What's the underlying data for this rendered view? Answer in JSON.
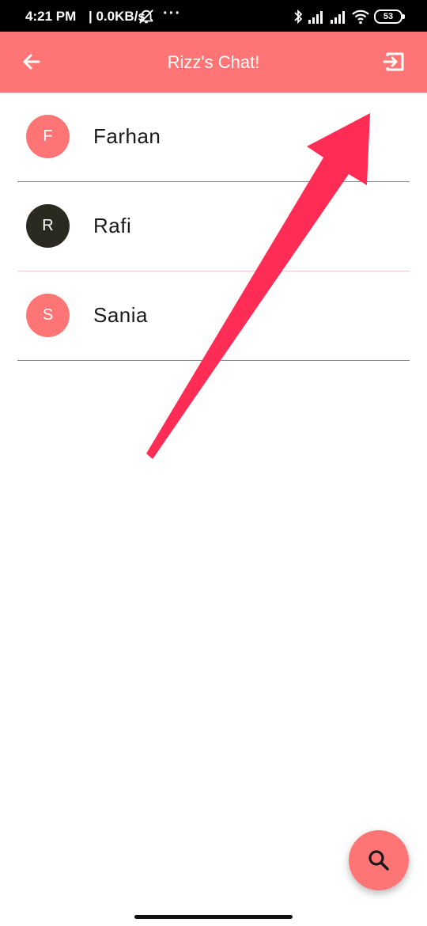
{
  "status_bar": {
    "time": "4:21 PM",
    "net_speed": "| 0.0KB/s",
    "more": "···",
    "battery": "53",
    "icons": [
      "alarm-off-icon",
      "bluetooth-icon",
      "signal-icon",
      "signal-icon",
      "wifi-icon",
      "battery-icon"
    ]
  },
  "app_bar": {
    "title": "Rizz's Chat!",
    "back_icon": "arrow-left-icon",
    "logout_icon": "logout-icon",
    "background": "#ff7575"
  },
  "contacts": [
    {
      "initial": "F",
      "name": "Farhan",
      "avatar_color": "#ff7575"
    },
    {
      "initial": "R",
      "name": "Rafi",
      "avatar_color": "#2b2a20"
    },
    {
      "initial": "S",
      "name": "Sania",
      "avatar_color": "#ff7575"
    }
  ],
  "fab": {
    "icon": "search-icon",
    "background": "#ff7575"
  },
  "annotation": {
    "arrow_color": "#ff2d55",
    "points_to": "logout-button"
  }
}
